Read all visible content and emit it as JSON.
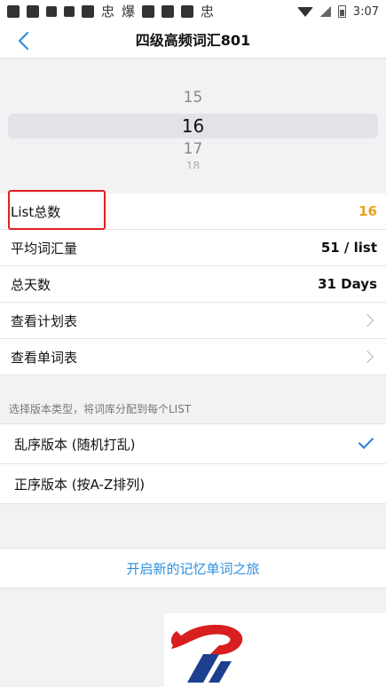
{
  "status_bar": {
    "time": "3:07",
    "glyphs": [
      "忠",
      "爆",
      "忠"
    ]
  },
  "nav": {
    "title": "四级高频词汇801"
  },
  "picker": {
    "values": [
      "15",
      "16",
      "17",
      "18"
    ],
    "selected": "16"
  },
  "stats": {
    "list_total_label": "List总数",
    "list_total_value": "16",
    "avg_words_label": "平均词汇量",
    "avg_words_value": "51 / list",
    "total_days_label": "总天数",
    "total_days_value": "31 Days",
    "view_plan_label": "查看计划表",
    "view_words_label": "查看单词表"
  },
  "version": {
    "section_label": "选择版本类型，将词库分配到每个LIST",
    "options": [
      {
        "label": "乱序版本 (随机打乱)",
        "selected": true
      },
      {
        "label": "正序版本 (按A-Z排列)",
        "selected": false
      }
    ]
  },
  "start_button": "开启新的记忆单词之旅",
  "colors": {
    "accent_orange": "#e8a21b",
    "link_blue": "#2f8fde",
    "highlight_red": "#e02020"
  }
}
